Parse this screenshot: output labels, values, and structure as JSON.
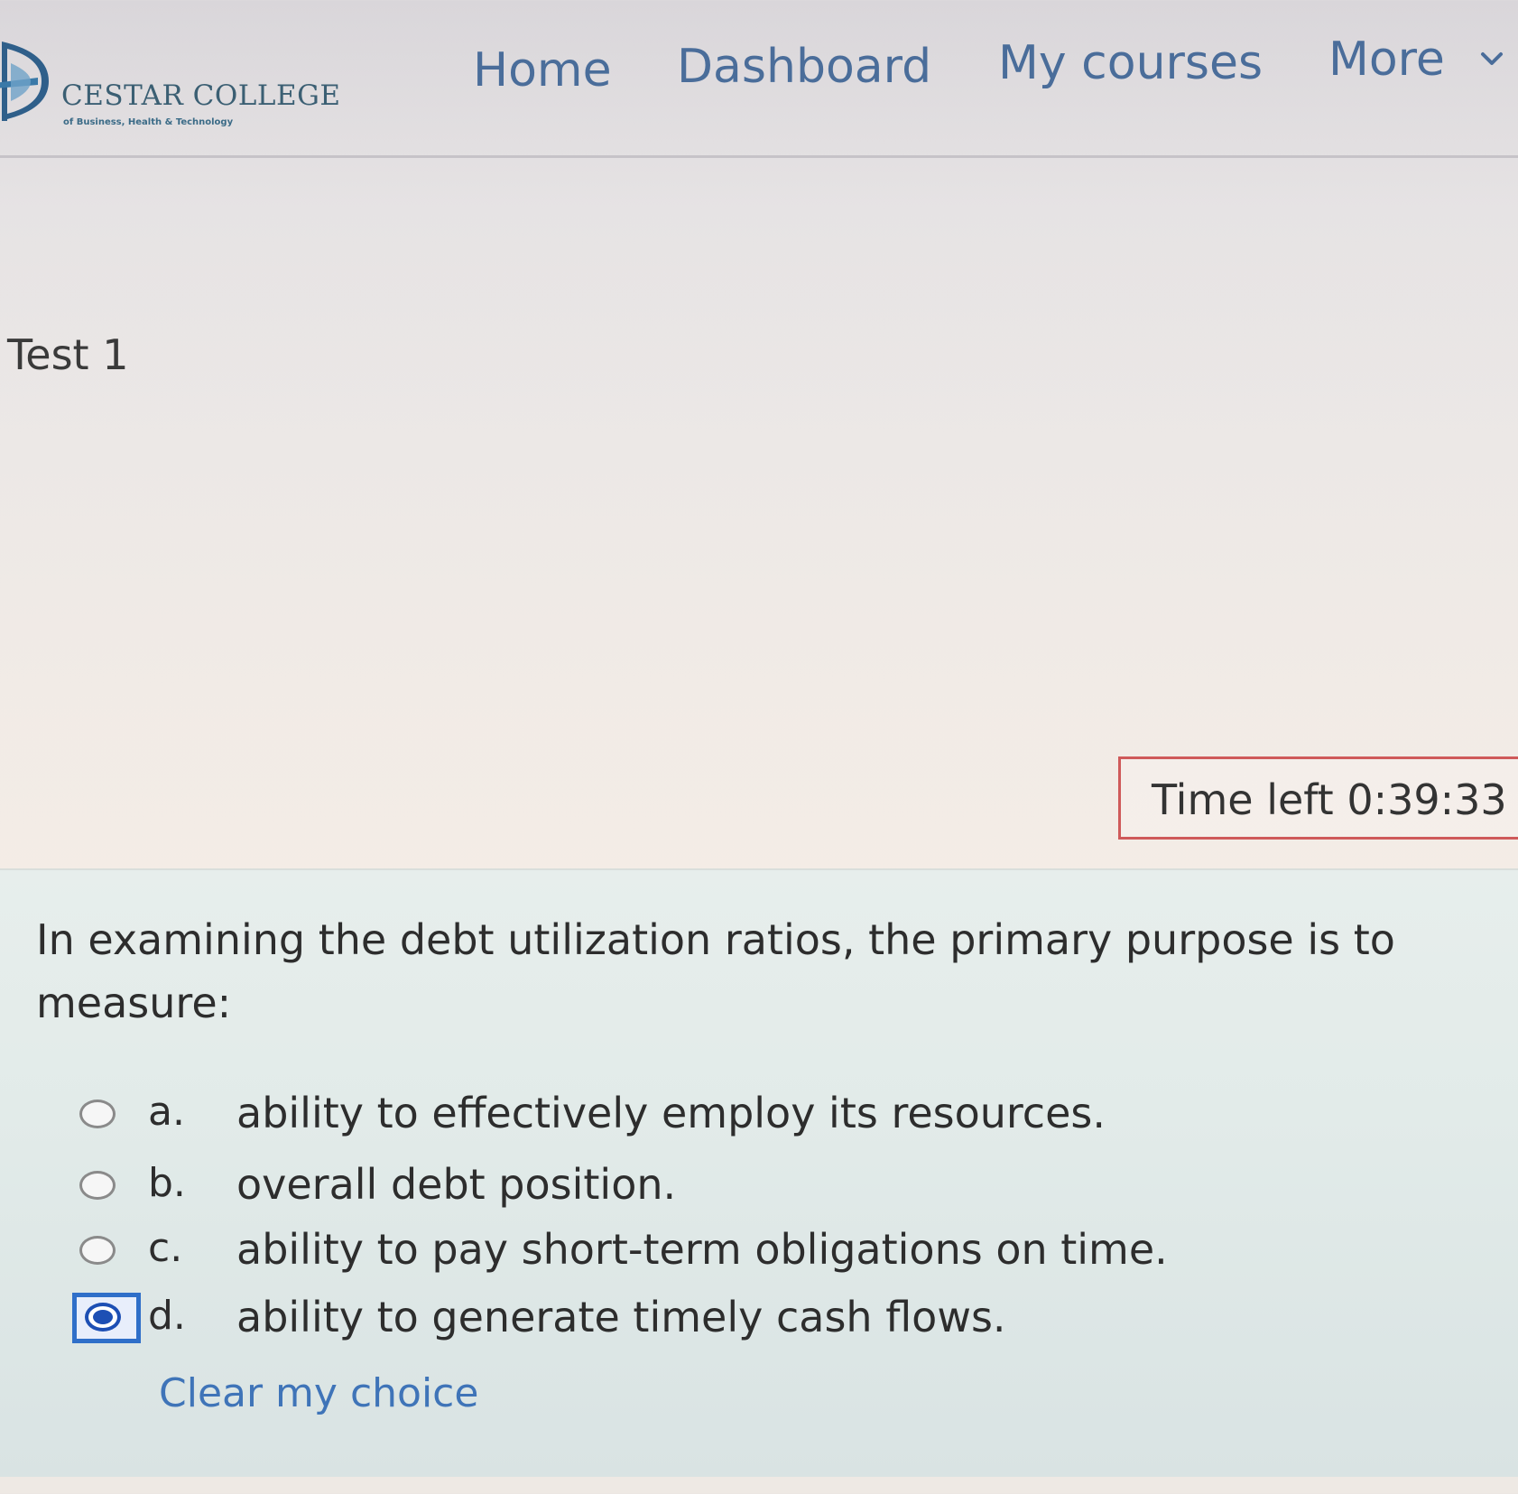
{
  "header": {
    "logo_name": "CESTAR COLLEGE",
    "logo_tagline": "of Business, Health & Technology",
    "nav": {
      "home": "Home",
      "dashboard": "Dashboard",
      "my_courses": "My courses",
      "more": "More"
    }
  },
  "page": {
    "title": "Test 1"
  },
  "timer": {
    "text": "Time left 0:39:33"
  },
  "question": {
    "text": "In examining the debt utilization ratios, the primary purpose is to measure:",
    "options": [
      {
        "letter": "a.",
        "text": "ability to effectively employ its resources.",
        "selected": false
      },
      {
        "letter": "b.",
        "text": "overall debt position.",
        "selected": false
      },
      {
        "letter": "c.",
        "text": "ability to pay short-term obligations on time.",
        "selected": false
      },
      {
        "letter": "d.",
        "text": "ability to generate timely cash flows.",
        "selected": true
      }
    ],
    "clear_label": "Clear my choice"
  },
  "colors": {
    "nav_link": "#4a6d9a",
    "timer_border": "#cf5a5a",
    "selected_radio": "#1d4fb4",
    "link": "#3f74b8"
  }
}
